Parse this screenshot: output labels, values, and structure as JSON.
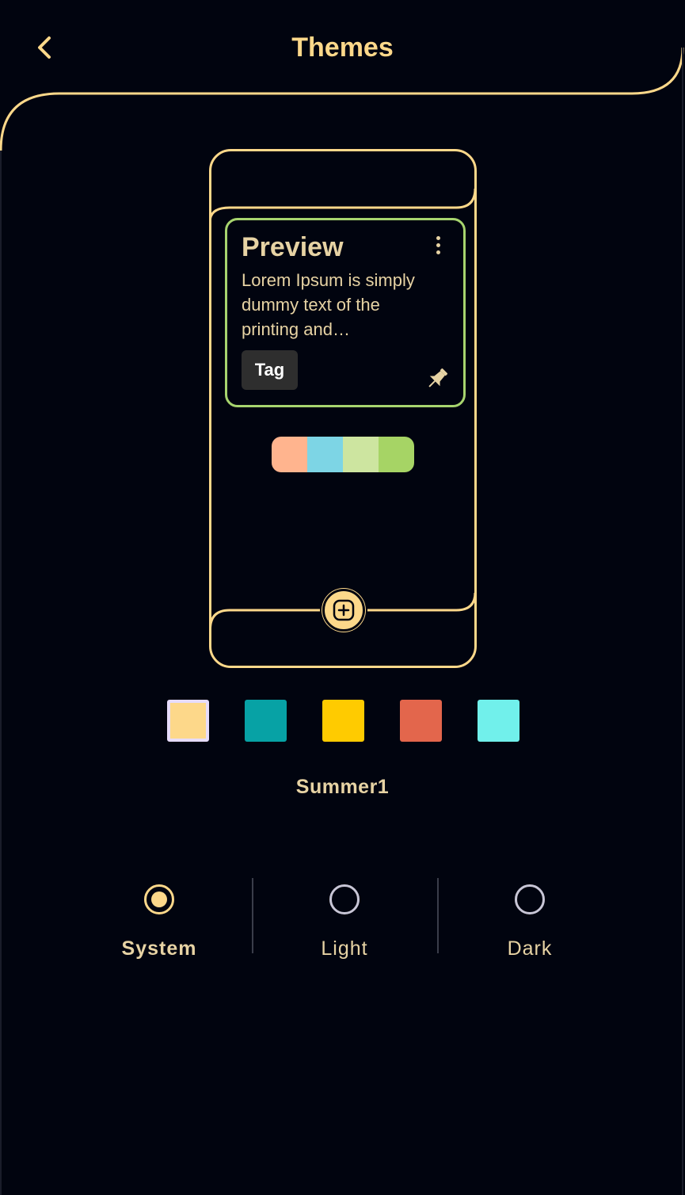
{
  "header": {
    "title": "Themes",
    "back_icon": "chevron-left-icon"
  },
  "preview": {
    "title": "Preview",
    "body": "Lorem Ipsum is simply dummy text of the printing and typesetting industry.",
    "tag": "Tag",
    "menu_icon": "more-vertical-icon",
    "pin_icon": "pin-icon",
    "add_icon": "add-square-icon",
    "palette": [
      "#ffb48e",
      "#7dd5e5",
      "#cde5a0",
      "#a6d465"
    ]
  },
  "colors": {
    "accent": "#fdd88a",
    "card_border": "#a7d46e",
    "text": "#e7d3a4",
    "background": "#01040f"
  },
  "swatches": [
    {
      "color": "#fdd88a",
      "selected": true
    },
    {
      "color": "#07a2a5",
      "selected": false
    },
    {
      "color": "#ffcb00",
      "selected": false
    },
    {
      "color": "#e3664c",
      "selected": false
    },
    {
      "color": "#71f0eb",
      "selected": false
    }
  ],
  "theme_name": "Summer1",
  "modes": [
    {
      "label": "System",
      "selected": true
    },
    {
      "label": "Light",
      "selected": false
    },
    {
      "label": "Dark",
      "selected": false
    }
  ]
}
